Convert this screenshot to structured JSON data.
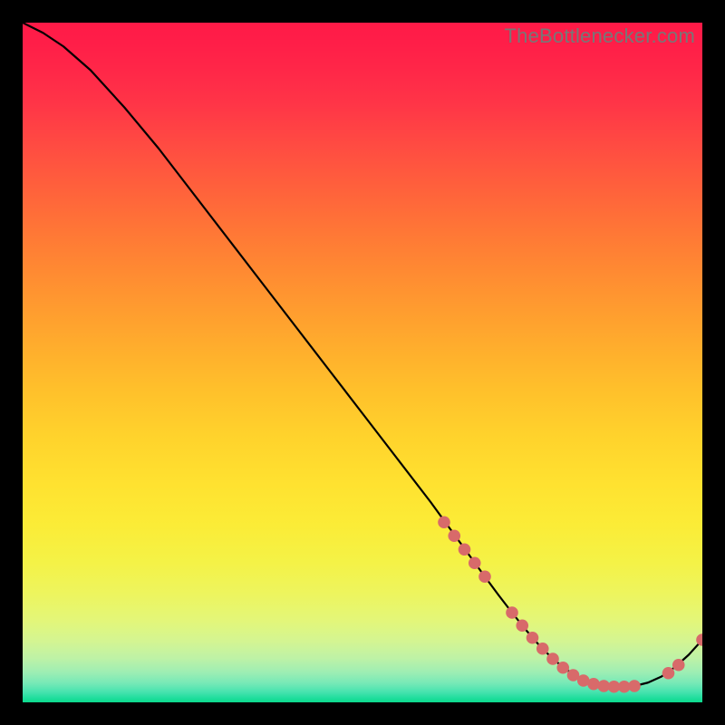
{
  "watermark": "TheBottlenecker.com",
  "chart_data": {
    "type": "line",
    "title": "",
    "xlabel": "",
    "ylabel": "",
    "xlim": [
      0,
      100
    ],
    "ylim": [
      0,
      100
    ],
    "grid": false,
    "x": [
      0,
      3,
      6,
      10,
      15,
      20,
      25,
      30,
      35,
      40,
      45,
      50,
      55,
      60,
      64,
      68,
      70,
      72,
      74,
      76,
      78,
      80,
      82,
      84,
      86,
      88,
      90,
      92,
      94,
      96,
      98,
      100
    ],
    "values": [
      100,
      98.5,
      96.5,
      93,
      87.5,
      81.5,
      75,
      68.5,
      62,
      55.5,
      49,
      42.5,
      36,
      29.5,
      24,
      18.5,
      15.8,
      13.2,
      10.7,
      8.4,
      6.4,
      4.8,
      3.6,
      2.8,
      2.4,
      2.3,
      2.4,
      2.9,
      3.8,
      5.2,
      7.0,
      9.2
    ],
    "markers_x": [
      62,
      63.5,
      65,
      66.5,
      68,
      72,
      73.5,
      75,
      76.5,
      78,
      79.5,
      81,
      82.5,
      84,
      85.5,
      87,
      88.5,
      90,
      95,
      96.5,
      100
    ],
    "markers_y": [
      26.5,
      24.5,
      22.5,
      20.5,
      18.5,
      13.2,
      11.3,
      9.5,
      7.9,
      6.4,
      5.1,
      4.0,
      3.2,
      2.7,
      2.4,
      2.3,
      2.3,
      2.4,
      4.3,
      5.5,
      9.2
    ],
    "gradient_stops": [
      {
        "offset": 0.0,
        "color": "#ff1a47"
      },
      {
        "offset": 0.03,
        "color": "#ff1e48"
      },
      {
        "offset": 0.07,
        "color": "#ff2748"
      },
      {
        "offset": 0.12,
        "color": "#ff3547"
      },
      {
        "offset": 0.18,
        "color": "#ff4b42"
      },
      {
        "offset": 0.25,
        "color": "#ff633b"
      },
      {
        "offset": 0.32,
        "color": "#ff7b35"
      },
      {
        "offset": 0.4,
        "color": "#ff9530"
      },
      {
        "offset": 0.47,
        "color": "#ffab2d"
      },
      {
        "offset": 0.54,
        "color": "#ffc02b"
      },
      {
        "offset": 0.61,
        "color": "#ffd32c"
      },
      {
        "offset": 0.68,
        "color": "#ffe230"
      },
      {
        "offset": 0.74,
        "color": "#fbec37"
      },
      {
        "offset": 0.795,
        "color": "#f4f247"
      },
      {
        "offset": 0.84,
        "color": "#edf55e"
      },
      {
        "offset": 0.88,
        "color": "#e3f679"
      },
      {
        "offset": 0.91,
        "color": "#d4f592"
      },
      {
        "offset": 0.935,
        "color": "#bef2a6"
      },
      {
        "offset": 0.955,
        "color": "#9feeb3"
      },
      {
        "offset": 0.972,
        "color": "#76e9b7"
      },
      {
        "offset": 0.985,
        "color": "#46e3ae"
      },
      {
        "offset": 0.993,
        "color": "#22de9e"
      },
      {
        "offset": 1.0,
        "color": "#0bda8c"
      }
    ]
  }
}
